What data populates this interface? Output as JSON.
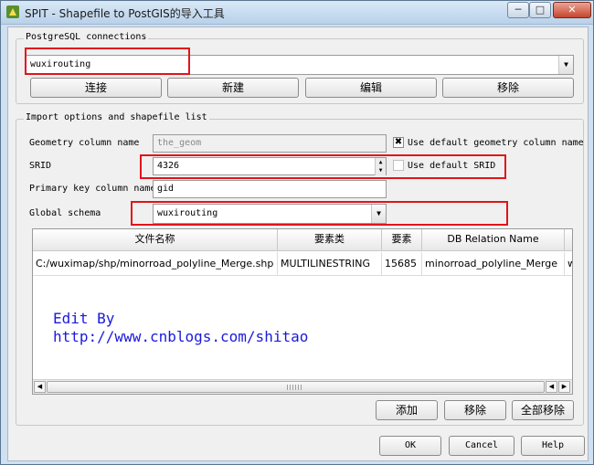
{
  "window": {
    "title": "SPIT - Shapefile to PostGIS的导入工具",
    "icon": "qgis-icon",
    "controls": {
      "minimize": "─",
      "maximize": "□",
      "close": "✕"
    }
  },
  "connections": {
    "group_title": "PostgreSQL connections",
    "selected": "wuxirouting",
    "buttons": {
      "connect": "连接",
      "new": "新建",
      "edit": "编辑",
      "remove": "移除"
    }
  },
  "import": {
    "group_title": "Import options and shapefile list",
    "geometry_label": "Geometry column name",
    "geometry_value": "the_geom",
    "use_default_geometry": "Use default geometry column name",
    "use_default_geometry_checked": true,
    "srid_label": "SRID",
    "srid_value": "4326",
    "use_default_srid": "Use default SRID",
    "use_default_srid_checked": false,
    "pk_label": "Primary key column name",
    "pk_value": "gid",
    "schema_label": "Global schema",
    "schema_value": "wuxirouting"
  },
  "table": {
    "columns": [
      "文件名称",
      "要素类",
      "要素",
      "DB Relation Name",
      ""
    ],
    "rows": [
      [
        "C:/wuximap/shp/minorroad_polyline_Merge.shp",
        "MULTILINESTRING",
        "15685",
        "minorroad_polyline_Merge",
        "w"
      ]
    ]
  },
  "watermark": {
    "line1": "Edit By",
    "line2": "http://www.cnblogs.com/shitao"
  },
  "file_buttons": {
    "add": "添加",
    "remove": "移除",
    "remove_all": "全部移除"
  },
  "dialog_buttons": {
    "ok": "OK",
    "cancel": "Cancel",
    "help": "Help"
  },
  "colors": {
    "highlight": "#e0141b",
    "watermark": "#1a1adc"
  }
}
